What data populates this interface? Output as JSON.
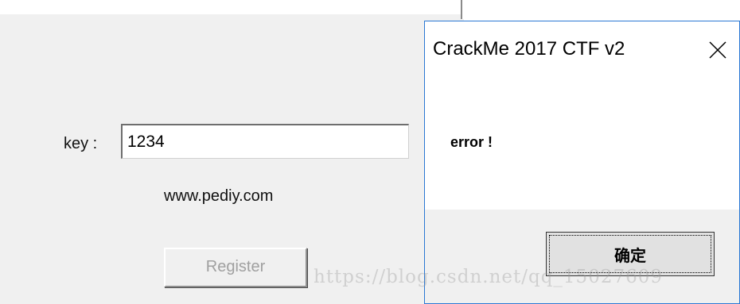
{
  "main_window": {
    "key_label": "key :",
    "key_value": "1234",
    "site_text": "www.pediy.com",
    "register_label": "Register"
  },
  "dialog": {
    "title": "CrackMe 2017 CTF v2",
    "message": "error !",
    "ok_label": "确定",
    "close_icon": "close-icon",
    "border_color": "#2b78d4"
  },
  "watermark": {
    "text": "https://blog.csdn.net/qq_15027609"
  }
}
